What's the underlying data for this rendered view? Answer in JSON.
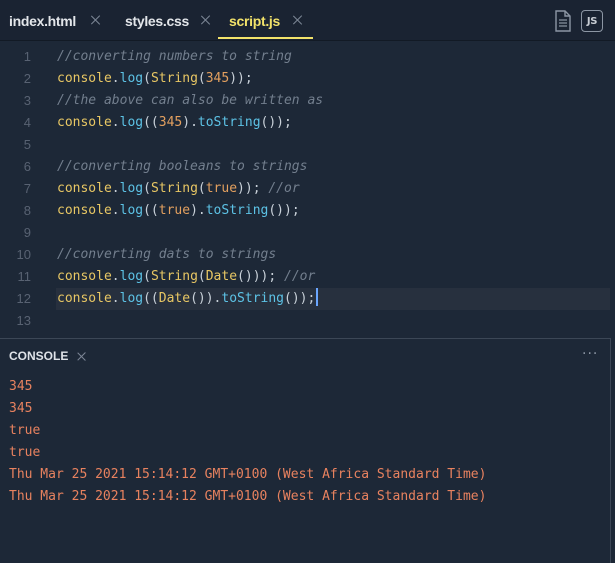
{
  "tabs": [
    {
      "label": "index.html",
      "active": false
    },
    {
      "label": "styles.css",
      "active": false
    },
    {
      "label": "script.js",
      "active": true
    }
  ],
  "toolbar": {
    "page_icon": "document-icon",
    "js_badge": "JS"
  },
  "editor": {
    "lines": [
      {
        "n": "1",
        "tokens": [
          [
            "comment",
            "//converting numbers to string"
          ]
        ]
      },
      {
        "n": "2",
        "tokens": [
          [
            "obj",
            "console"
          ],
          [
            "punc",
            "."
          ],
          [
            "fn",
            "log"
          ],
          [
            "punc",
            "("
          ],
          [
            "obj",
            "String"
          ],
          [
            "punc",
            "("
          ],
          [
            "num",
            "345"
          ],
          [
            "punc",
            "));"
          ]
        ]
      },
      {
        "n": "3",
        "tokens": [
          [
            "comment",
            "//the above can also be written as"
          ]
        ]
      },
      {
        "n": "4",
        "tokens": [
          [
            "obj",
            "console"
          ],
          [
            "punc",
            "."
          ],
          [
            "fn",
            "log"
          ],
          [
            "punc",
            "(("
          ],
          [
            "num",
            "345"
          ],
          [
            "punc",
            ")."
          ],
          [
            "fn",
            "toString"
          ],
          [
            "punc",
            "());"
          ]
        ]
      },
      {
        "n": "5",
        "tokens": []
      },
      {
        "n": "6",
        "tokens": [
          [
            "comment",
            "//converting booleans to strings"
          ]
        ]
      },
      {
        "n": "7",
        "tokens": [
          [
            "obj",
            "console"
          ],
          [
            "punc",
            "."
          ],
          [
            "fn",
            "log"
          ],
          [
            "punc",
            "("
          ],
          [
            "obj",
            "String"
          ],
          [
            "punc",
            "("
          ],
          [
            "kw",
            "true"
          ],
          [
            "punc",
            "));"
          ],
          [
            "punc",
            " "
          ],
          [
            "comment",
            "//or"
          ]
        ]
      },
      {
        "n": "8",
        "tokens": [
          [
            "obj",
            "console"
          ],
          [
            "punc",
            "."
          ],
          [
            "fn",
            "log"
          ],
          [
            "punc",
            "(("
          ],
          [
            "kw",
            "true"
          ],
          [
            "punc",
            ")."
          ],
          [
            "fn",
            "toString"
          ],
          [
            "punc",
            "());"
          ]
        ]
      },
      {
        "n": "9",
        "tokens": []
      },
      {
        "n": "10",
        "tokens": [
          [
            "comment",
            "//converting dats to strings"
          ]
        ]
      },
      {
        "n": "11",
        "tokens": [
          [
            "obj",
            "console"
          ],
          [
            "punc",
            "."
          ],
          [
            "fn",
            "log"
          ],
          [
            "punc",
            "("
          ],
          [
            "obj",
            "String"
          ],
          [
            "punc",
            "("
          ],
          [
            "obj",
            "Date"
          ],
          [
            "punc",
            "()));"
          ],
          [
            "punc",
            " "
          ],
          [
            "comment",
            "//or"
          ]
        ]
      },
      {
        "n": "12",
        "tokens": [
          [
            "obj",
            "console"
          ],
          [
            "punc",
            "."
          ],
          [
            "fn",
            "log"
          ],
          [
            "punc",
            "(("
          ],
          [
            "obj",
            "Date"
          ],
          [
            "punc",
            "())."
          ],
          [
            "fn",
            "toString"
          ],
          [
            "punc",
            "());"
          ]
        ],
        "cursor": true
      },
      {
        "n": "13",
        "tokens": []
      }
    ]
  },
  "console": {
    "title": "CONSOLE",
    "menu": "···",
    "output": [
      "345",
      "345",
      "true",
      "true",
      "Thu Mar 25 2021 15:14:12 GMT+0100 (West Africa Standard Time)",
      "Thu Mar 25 2021 15:14:12 GMT+0100 (West Africa Standard Time)"
    ]
  },
  "colors": {
    "background": "#1d2837",
    "active_tab": "#f2e26a",
    "comment": "#737f8e",
    "identifier": "#e8c764",
    "method": "#5dc3e6",
    "literal": "#e3a05f",
    "console_output": "#e8825f"
  }
}
